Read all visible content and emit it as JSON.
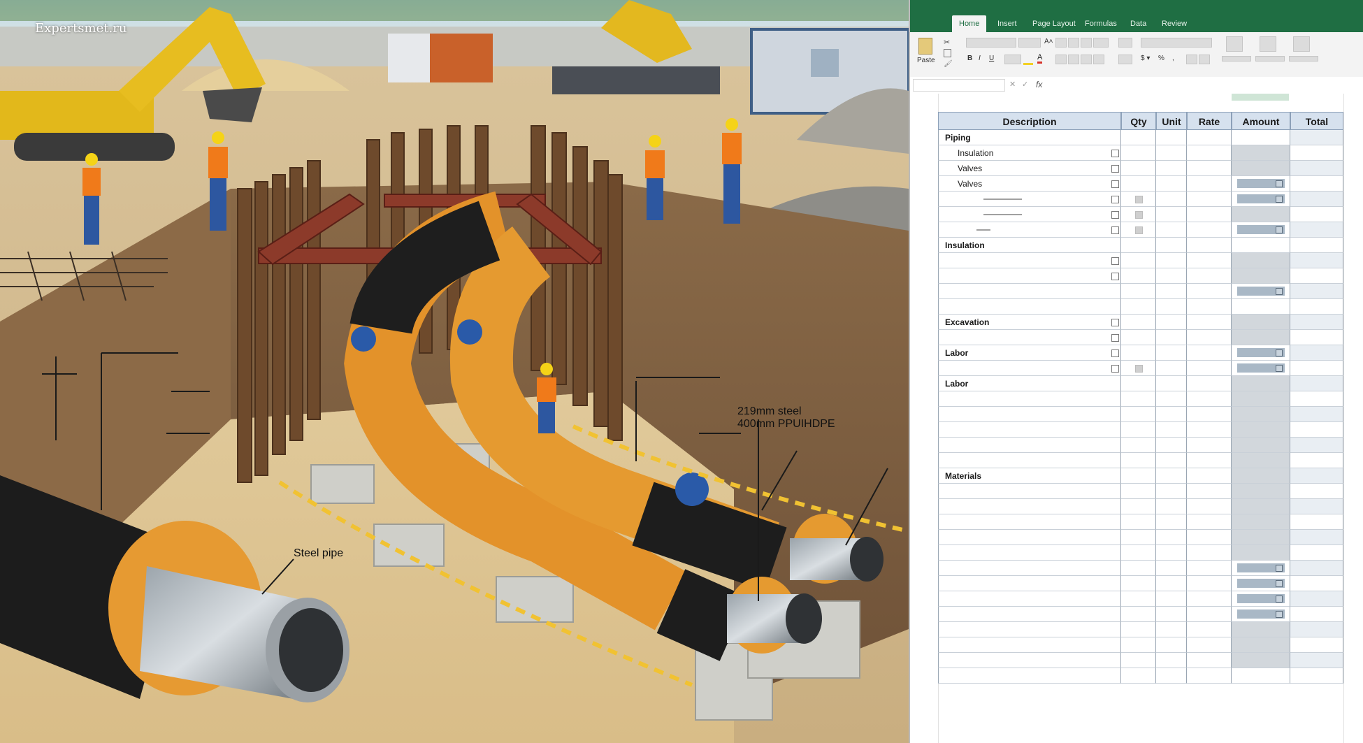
{
  "watermark": "Expertsmet.ru",
  "scene": {
    "callouts": {
      "pipe_spec_line1": "219mm steel",
      "pipe_spec_line2": "400mm PPUIHDPE",
      "steel_pipe": "Steel pipe"
    }
  },
  "spreadsheet": {
    "tabs": [
      "Home",
      "Insert",
      "Page Layout",
      "Formulas",
      "Data",
      "Review"
    ],
    "active_tab": "Home",
    "paste_label": "Paste",
    "formula_bar_icon": "fx",
    "headers": {
      "description": "Description",
      "qty": "Qty",
      "unit": "Unit",
      "rate": "Rate",
      "amount": "Amount",
      "total": "Total"
    },
    "rows": {
      "r0": "Piping",
      "r1": "Insulation",
      "r2": "Valves",
      "r3": "Valves",
      "r7": "Insulation",
      "r12": "Excavation",
      "r14": "Labor",
      "r16": "Labor",
      "r22": "Materials"
    },
    "colors": {
      "ribbon_green": "#1f6e43",
      "header_fill": "#d6e1ee",
      "amount_fill": "#a9b8c6"
    }
  }
}
